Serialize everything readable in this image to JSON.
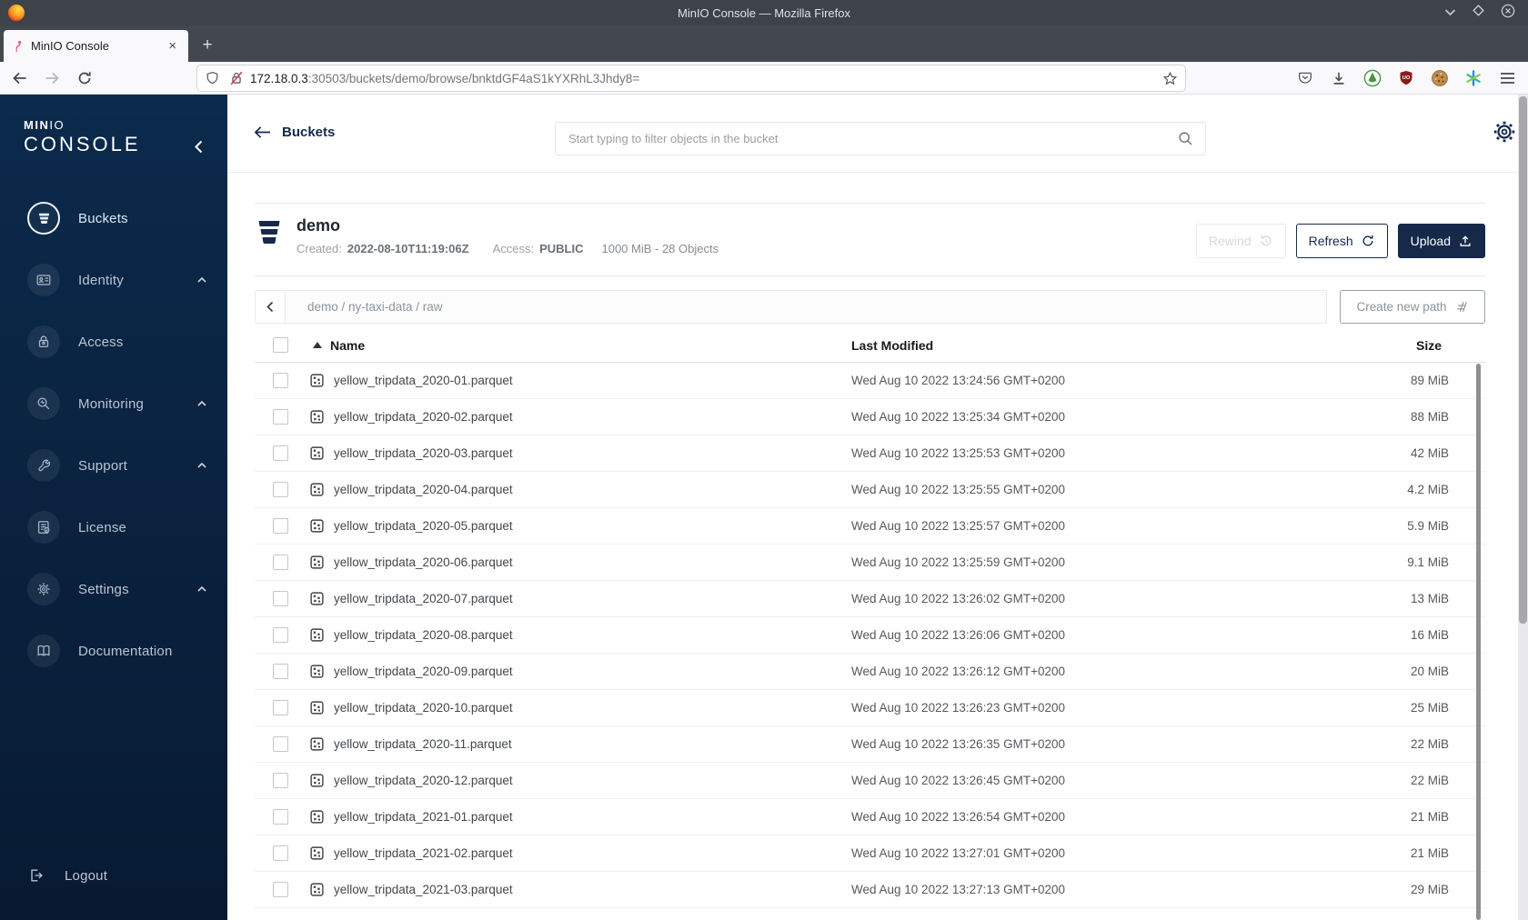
{
  "colors": {
    "accent_navy": "#16294b",
    "sidebar_top": "#0b2a4c",
    "sidebar_bottom": "#081a32"
  },
  "browser": {
    "window_title": "MinIO Console — Mozilla Firefox",
    "tab_title": "MinIO Console",
    "new_tab_button": "+",
    "tab_close": "×",
    "url_domain": "172.18.0.3",
    "url_rest": ":30503/buckets/demo/browse/bnktdGF4aS1kYXRhL3Jhdy8=",
    "window_controls": [
      "minimize",
      "maximize",
      "close"
    ],
    "toolbar_icons": [
      "back",
      "forward",
      "reload",
      "tracking-shield",
      "insecure-lock",
      "bookmark-star",
      "pocket",
      "download",
      "privacy-badger",
      "ublock-origin",
      "cookie-extension",
      "asterisk-extension",
      "menu"
    ]
  },
  "sidebar": {
    "logo_primary": "MIN",
    "logo_secondary": "IO",
    "logo_word": "CONSOLE",
    "items": [
      {
        "label": "Buckets",
        "active": true,
        "caret": false
      },
      {
        "label": "Identity",
        "active": false,
        "caret": true
      },
      {
        "label": "Access",
        "active": false,
        "caret": false
      },
      {
        "label": "Monitoring",
        "active": false,
        "caret": true
      },
      {
        "label": "Support",
        "active": false,
        "caret": true
      },
      {
        "label": "License",
        "active": false,
        "caret": false
      },
      {
        "label": "Settings",
        "active": false,
        "caret": true
      },
      {
        "label": "Documentation",
        "active": false,
        "caret": false
      }
    ],
    "logout_label": "Logout"
  },
  "header": {
    "back_label": "Buckets",
    "search_placeholder": "Start typing to filter objects in the bucket"
  },
  "bucket": {
    "name": "demo",
    "created_label": "Created:",
    "created_value": "2022-08-10T11:19:06Z",
    "access_label": "Access:",
    "access_value": "PUBLIC",
    "summary": "1000 MiB - 28 Objects",
    "rewind_label": "Rewind",
    "refresh_label": "Refresh",
    "upload_label": "Upload"
  },
  "pathbar": {
    "path": "demo / ny-taxi-data / raw",
    "create_path_label": "Create new path"
  },
  "table": {
    "columns": [
      "Name",
      "Last Modified",
      "Size"
    ],
    "rows": [
      {
        "name": "yellow_tripdata_2020-01.parquet",
        "modified": "Wed Aug 10 2022 13:24:56 GMT+0200",
        "size": "89 MiB"
      },
      {
        "name": "yellow_tripdata_2020-02.parquet",
        "modified": "Wed Aug 10 2022 13:25:34 GMT+0200",
        "size": "88 MiB"
      },
      {
        "name": "yellow_tripdata_2020-03.parquet",
        "modified": "Wed Aug 10 2022 13:25:53 GMT+0200",
        "size": "42 MiB"
      },
      {
        "name": "yellow_tripdata_2020-04.parquet",
        "modified": "Wed Aug 10 2022 13:25:55 GMT+0200",
        "size": "4.2 MiB"
      },
      {
        "name": "yellow_tripdata_2020-05.parquet",
        "modified": "Wed Aug 10 2022 13:25:57 GMT+0200",
        "size": "5.9 MiB"
      },
      {
        "name": "yellow_tripdata_2020-06.parquet",
        "modified": "Wed Aug 10 2022 13:25:59 GMT+0200",
        "size": "9.1 MiB"
      },
      {
        "name": "yellow_tripdata_2020-07.parquet",
        "modified": "Wed Aug 10 2022 13:26:02 GMT+0200",
        "size": "13 MiB"
      },
      {
        "name": "yellow_tripdata_2020-08.parquet",
        "modified": "Wed Aug 10 2022 13:26:06 GMT+0200",
        "size": "16 MiB"
      },
      {
        "name": "yellow_tripdata_2020-09.parquet",
        "modified": "Wed Aug 10 2022 13:26:12 GMT+0200",
        "size": "20 MiB"
      },
      {
        "name": "yellow_tripdata_2020-10.parquet",
        "modified": "Wed Aug 10 2022 13:26:23 GMT+0200",
        "size": "25 MiB"
      },
      {
        "name": "yellow_tripdata_2020-11.parquet",
        "modified": "Wed Aug 10 2022 13:26:35 GMT+0200",
        "size": "22 MiB"
      },
      {
        "name": "yellow_tripdata_2020-12.parquet",
        "modified": "Wed Aug 10 2022 13:26:45 GMT+0200",
        "size": "22 MiB"
      },
      {
        "name": "yellow_tripdata_2021-01.parquet",
        "modified": "Wed Aug 10 2022 13:26:54 GMT+0200",
        "size": "21 MiB"
      },
      {
        "name": "yellow_tripdata_2021-02.parquet",
        "modified": "Wed Aug 10 2022 13:27:01 GMT+0200",
        "size": "21 MiB"
      },
      {
        "name": "yellow_tripdata_2021-03.parquet",
        "modified": "Wed Aug 10 2022 13:27:13 GMT+0200",
        "size": "29 MiB"
      }
    ]
  }
}
